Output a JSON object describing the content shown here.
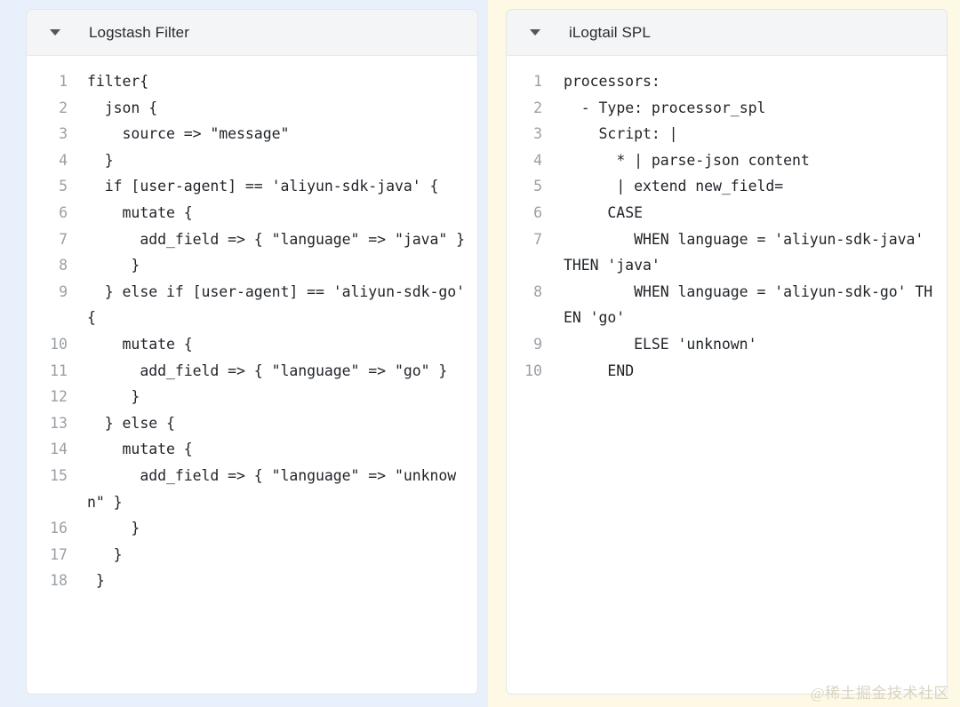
{
  "panels": [
    {
      "id": "logstash",
      "title": "Logstash Filter",
      "caret_icon": "caret-down-icon",
      "wrapper_color": "#e8f0fb",
      "card_color": "#ffffff",
      "header_color": "#f4f5f6",
      "lines": [
        {
          "n": "1",
          "text": "filter{"
        },
        {
          "n": "2",
          "text": "  json {"
        },
        {
          "n": "3",
          "text": "    source => \"message\""
        },
        {
          "n": "4",
          "text": "  }"
        },
        {
          "n": "5",
          "text": "  if [user-agent] == 'aliyun-sdk-java' {"
        },
        {
          "n": "6",
          "text": "    mutate {"
        },
        {
          "n": "7",
          "text": "      add_field => { \"language\" => \"java\" }"
        },
        {
          "n": "8",
          "text": "     }"
        },
        {
          "n": "9",
          "text": "  } else if [user-agent] == 'aliyun-sdk-go' {"
        },
        {
          "n": "10",
          "text": "    mutate {"
        },
        {
          "n": "11",
          "text": "      add_field => { \"language\" => \"go\" }"
        },
        {
          "n": "12",
          "text": "     }"
        },
        {
          "n": "13",
          "text": "  } else {"
        },
        {
          "n": "14",
          "text": "    mutate {"
        },
        {
          "n": "15",
          "text": "      add_field => { \"language\" => \"unknown\" }"
        },
        {
          "n": "16",
          "text": "     }"
        },
        {
          "n": "17",
          "text": "   }"
        },
        {
          "n": "18",
          "text": " }"
        }
      ]
    },
    {
      "id": "ilogtail",
      "title": "iLogtail SPL",
      "caret_icon": "caret-down-icon",
      "wrapper_color": "#fdf9e4",
      "card_color": "#ffffff",
      "header_color": "#f4f5f6",
      "lines": [
        {
          "n": "1",
          "text": "processors:"
        },
        {
          "n": "2",
          "text": "  - Type: processor_spl"
        },
        {
          "n": "3",
          "text": "    Script: |"
        },
        {
          "n": "4",
          "text": "      * | parse-json content"
        },
        {
          "n": "5",
          "text": "      | extend new_field="
        },
        {
          "n": "6",
          "text": "     CASE"
        },
        {
          "n": "7",
          "text": "        WHEN language = 'aliyun-sdk-java' THEN 'java'"
        },
        {
          "n": "8",
          "text": "        WHEN language = 'aliyun-sdk-go' THEN 'go'"
        },
        {
          "n": "9",
          "text": "        ELSE 'unknown'"
        },
        {
          "n": "10",
          "text": "     END"
        }
      ]
    }
  ],
  "watermark": {
    "text": "@稀土掘金技术社区",
    "color": "#d9d4c0"
  }
}
